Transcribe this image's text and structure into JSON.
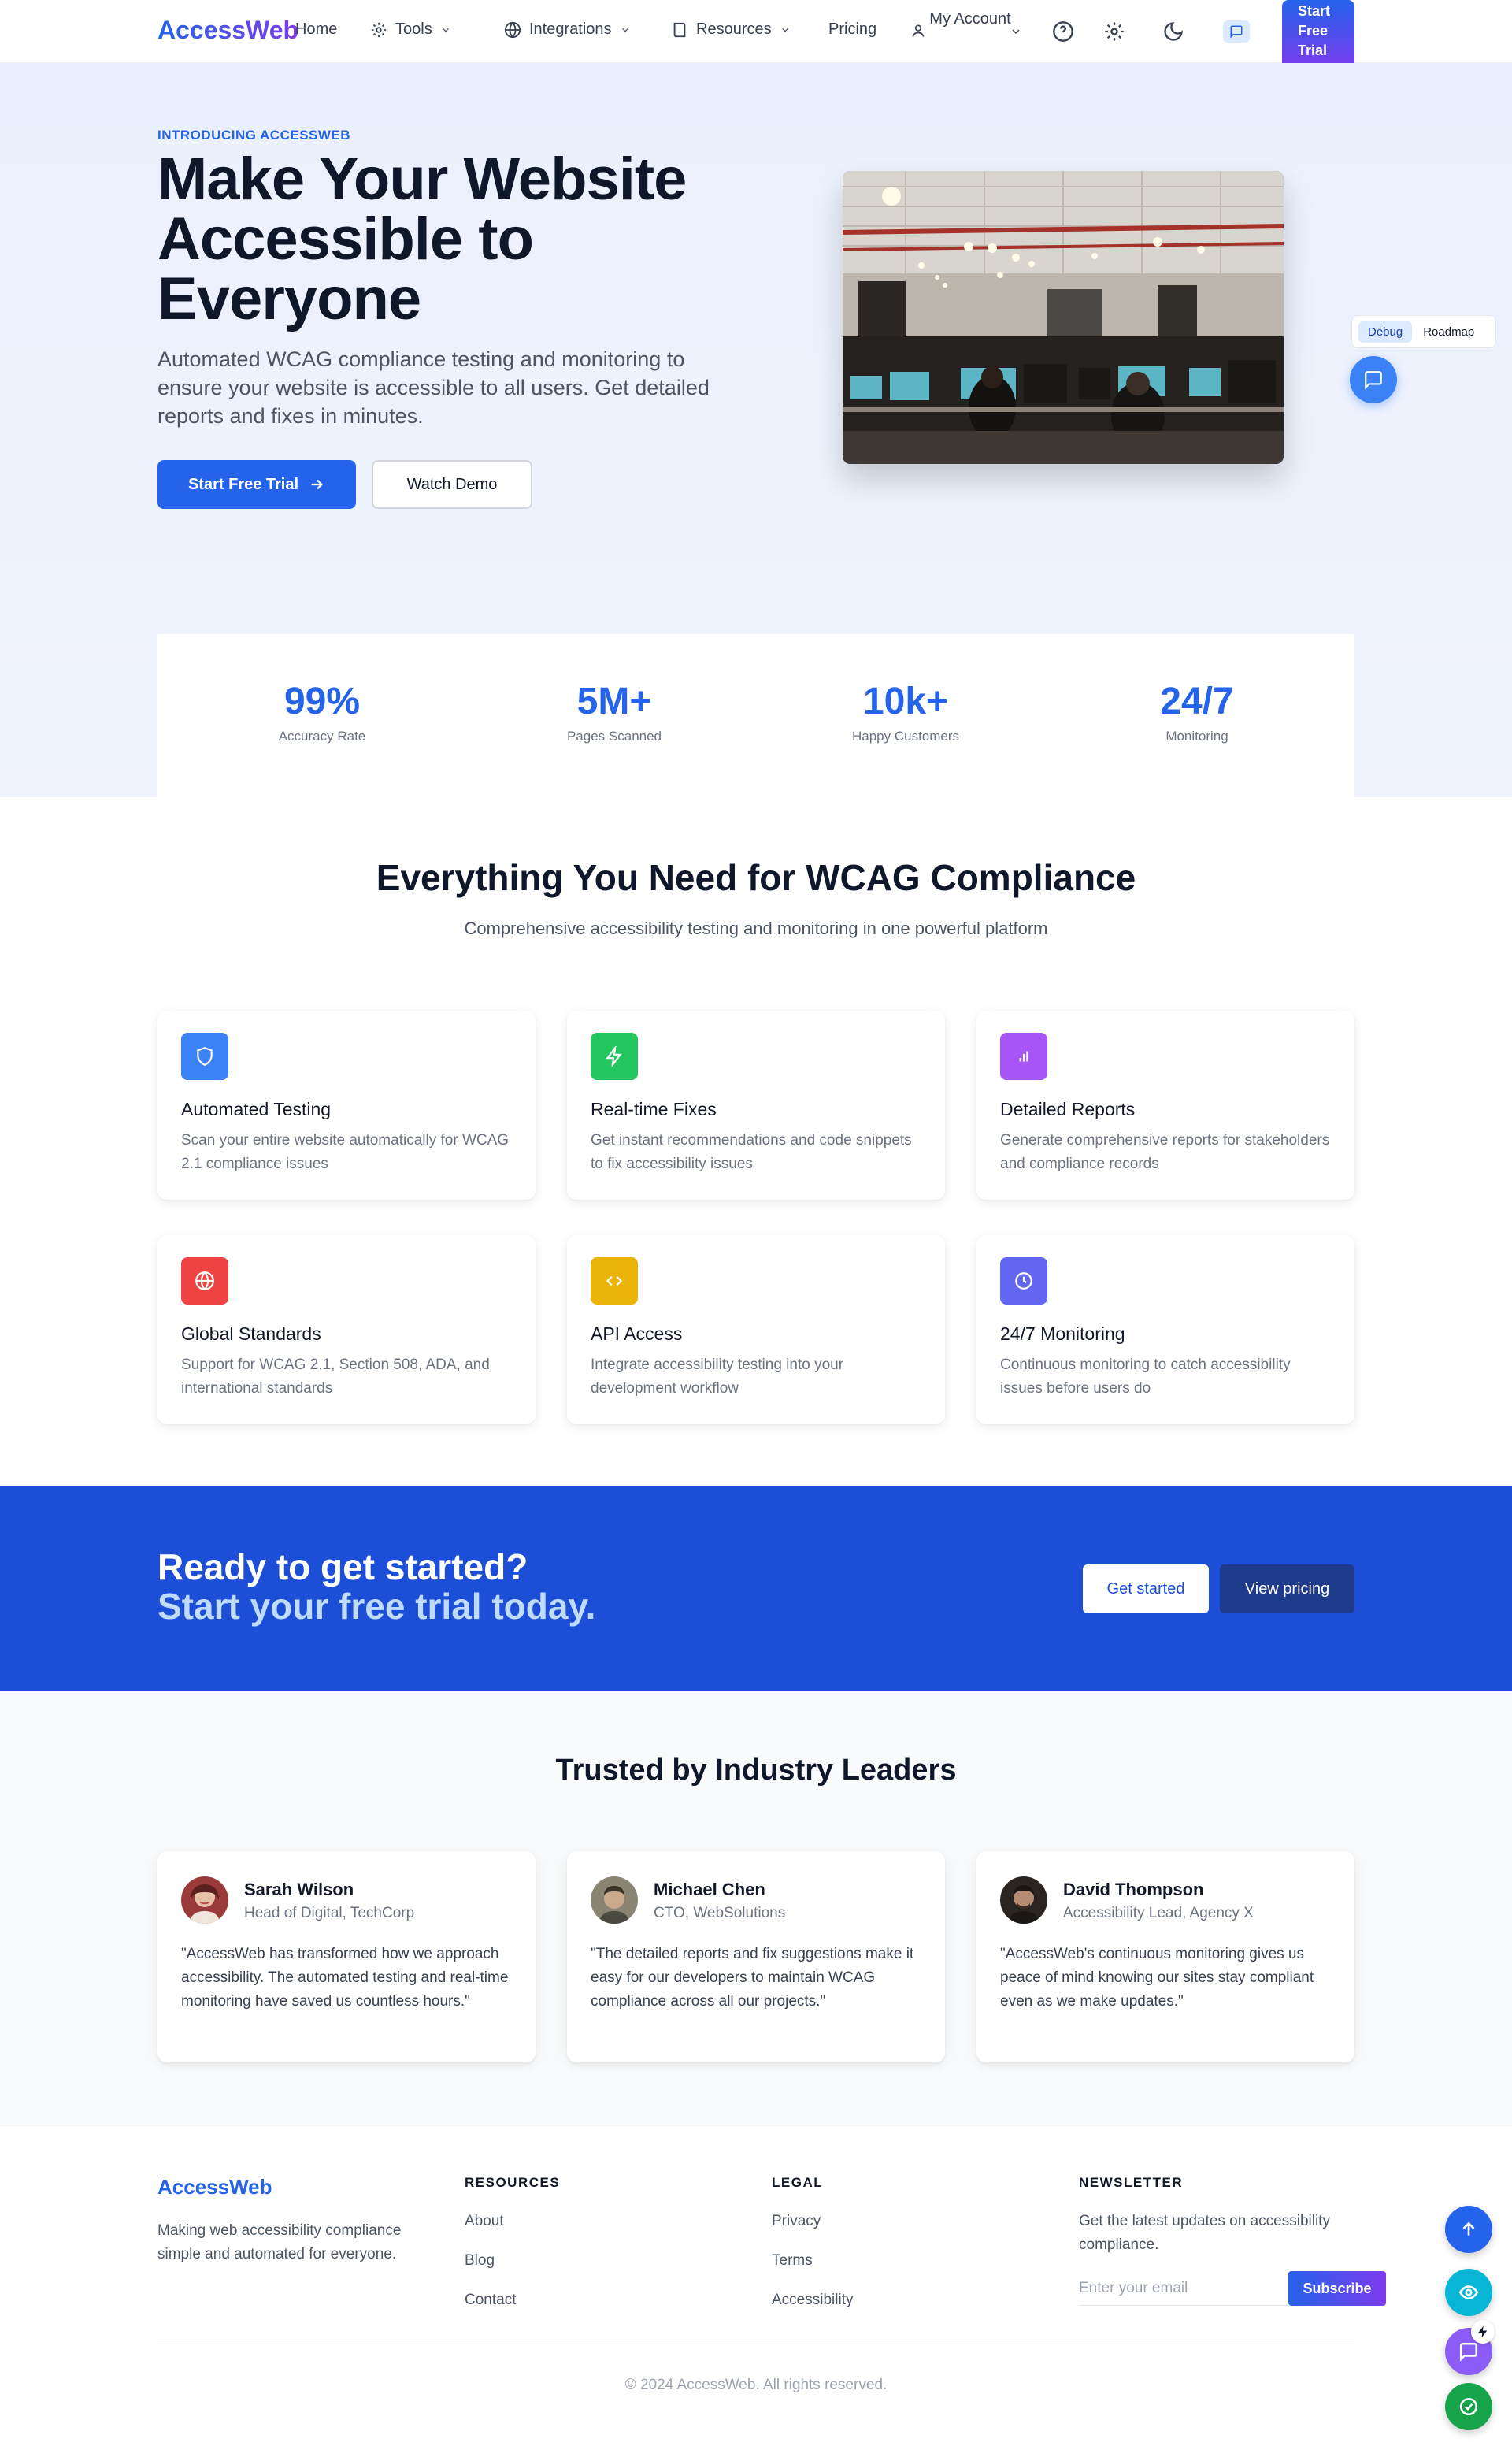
{
  "nav": {
    "brand": "AccessWeb",
    "home": "Home",
    "tools": "Tools",
    "integrations": "Integrations",
    "resources": "Resources",
    "pricing": "Pricing",
    "account": "My Account",
    "cta": "Start Free Trial"
  },
  "hero": {
    "eyebrow": "INTRODUCING ACCESSWEB",
    "title": "Make Your Website Accessible to Everyone",
    "subtitle": "Automated WCAG compliance testing and monitoring to ensure your website is accessible to all users. Get detailed reports and fixes in minutes.",
    "primary_button": "Start Free Trial",
    "secondary_button": "Watch Demo"
  },
  "debug_panel": {
    "tab1": "Debug",
    "tab2": "Roadmap"
  },
  "stats": [
    {
      "value": "99%",
      "label": "Accuracy Rate"
    },
    {
      "value": "5M+",
      "label": "Pages Scanned"
    },
    {
      "value": "10k+",
      "label": "Happy Customers"
    },
    {
      "value": "24/7",
      "label": "Monitoring"
    }
  ],
  "features": {
    "title": "Everything You Need for WCAG Compliance",
    "subtitle": "Comprehensive accessibility testing and monitoring in one powerful platform",
    "items": [
      {
        "title": "Automated Testing",
        "desc": "Scan your entire website automatically for WCAG 2.1 compliance issues",
        "icon": "shield-icon",
        "color": "#3b82f6"
      },
      {
        "title": "Real-time Fixes",
        "desc": "Get instant recommendations and code snippets to fix accessibility issues",
        "icon": "bolt-icon",
        "color": "#22c55e"
      },
      {
        "title": "Detailed Reports",
        "desc": "Generate comprehensive reports for stakeholders and compliance records",
        "icon": "bar-chart-icon",
        "color": "#a855f7"
      },
      {
        "title": "Global Standards",
        "desc": "Support for WCAG 2.1, Section 508, ADA, and international standards",
        "icon": "globe-icon",
        "color": "#ef4444"
      },
      {
        "title": "API Access",
        "desc": "Integrate accessibility testing into your development workflow",
        "icon": "code-icon",
        "color": "#eab308"
      },
      {
        "title": "24/7 Monitoring",
        "desc": "Continuous monitoring to catch accessibility issues before users do",
        "icon": "clock-icon",
        "color": "#6366f1"
      }
    ]
  },
  "cta": {
    "line1": "Ready to get started?",
    "line2": "Start your free trial today.",
    "button1": "Get started",
    "button2": "View pricing"
  },
  "testimonials": {
    "title": "Trusted by Industry Leaders",
    "items": [
      {
        "name": "Sarah Wilson",
        "role": "Head of Digital, TechCorp",
        "quote": "\"AccessWeb has transformed how we approach accessibility. The automated testing and real-time monitoring have saved us countless hours.\""
      },
      {
        "name": "Michael Chen",
        "role": "CTO, WebSolutions",
        "quote": "\"The detailed reports and fix suggestions make it easy for our developers to maintain WCAG compliance across all our projects.\""
      },
      {
        "name": "David Thompson",
        "role": "Accessibility Lead, Agency X",
        "quote": "\"AccessWeb's continuous monitoring gives us peace of mind knowing our sites stay compliant even as we make updates.\""
      }
    ]
  },
  "footer": {
    "brand": "AccessWeb",
    "desc": "Making web accessibility compliance simple and automated for everyone.",
    "resources_head": "RESOURCES",
    "resources": [
      "About",
      "Blog",
      "Contact"
    ],
    "legal_head": "LEGAL",
    "legal": [
      "Privacy",
      "Terms",
      "Accessibility"
    ],
    "newsletter_head": "NEWSLETTER",
    "newsletter_desc": "Get the latest updates on accessibility compliance.",
    "email_placeholder": "Enter your email",
    "subscribe": "Subscribe",
    "copyright": "© 2024 AccessWeb. All rights reserved."
  }
}
